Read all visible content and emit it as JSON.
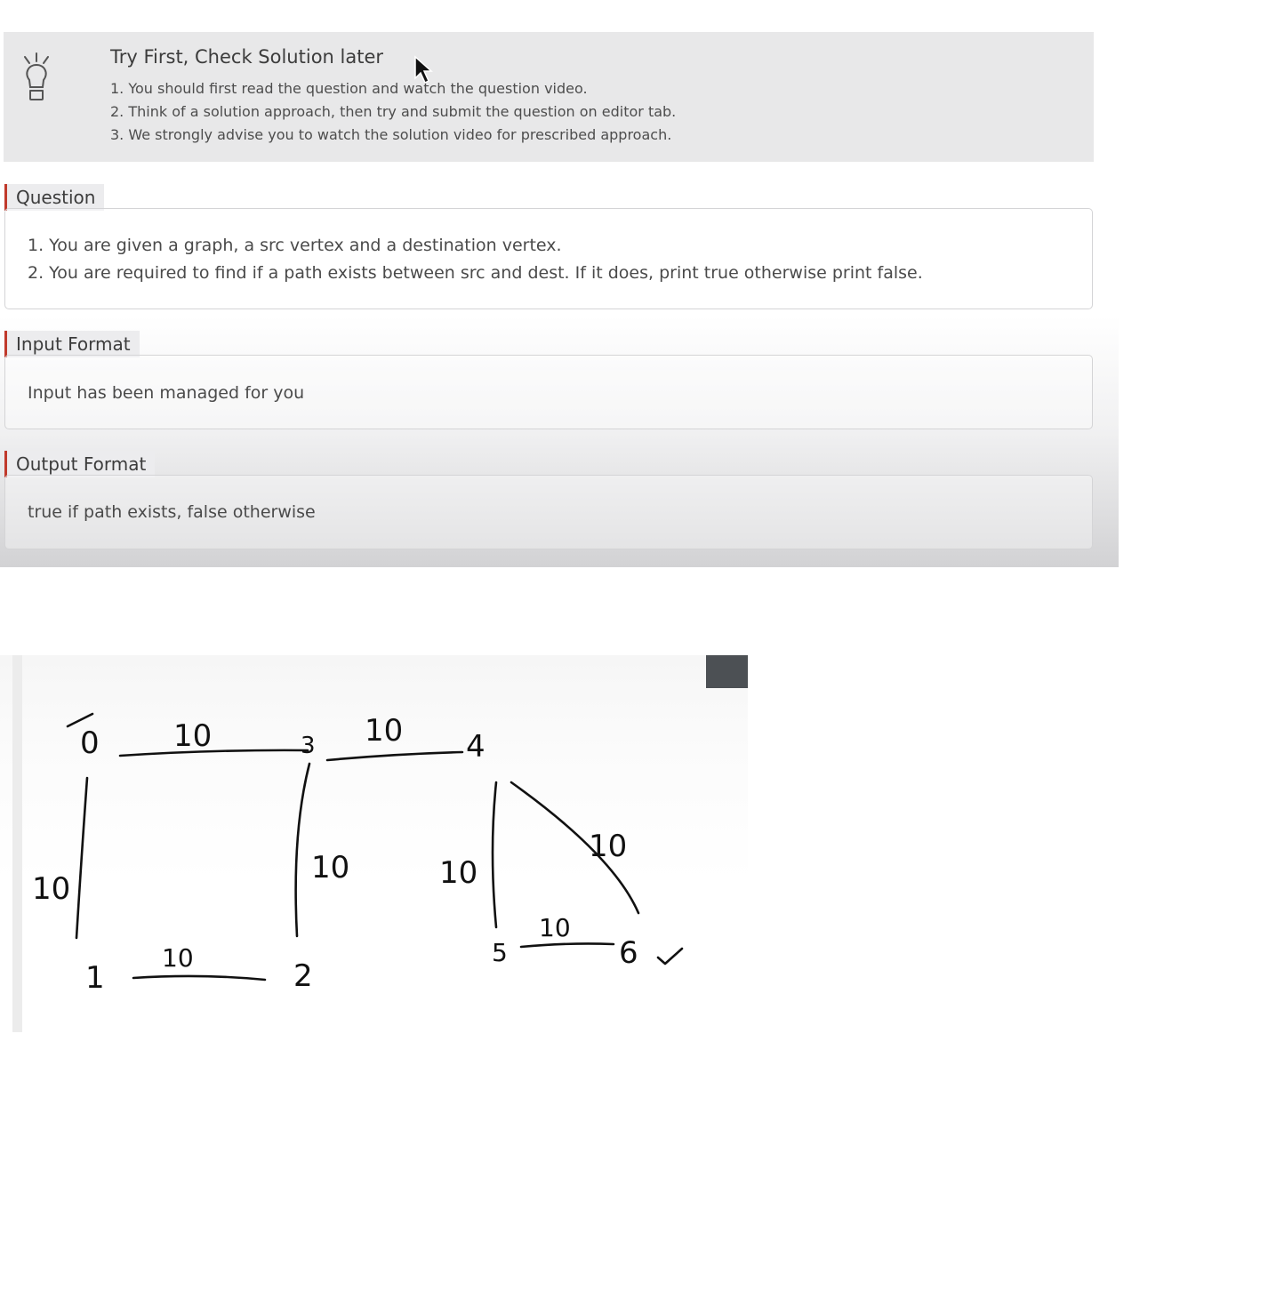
{
  "tip": {
    "title": "Try First, Check Solution later",
    "lines": [
      "1. You should first read the question and watch the question video.",
      "2. Think of a solution approach, then try and submit the question on editor tab.",
      "3. We strongly advise you to watch the solution video for prescribed approach."
    ],
    "icon": "lightbulb-icon"
  },
  "question": {
    "label": "Question",
    "lines": [
      "1. You are given a graph, a src vertex and a destination vertex.",
      "2. You are required to find if a path exists between src and dest. If it does, print true otherwise print false."
    ]
  },
  "input_format": {
    "label": "Input Format",
    "text": "Input has been managed for you"
  },
  "output_format": {
    "label": "Output Format",
    "text": "true if path exists, false otherwise"
  },
  "whiteboard": {
    "vertices": [
      "0",
      "1",
      "2",
      "3",
      "4",
      "5",
      "6"
    ],
    "edge_weights": [
      "10",
      "10",
      "10",
      "10",
      "10",
      "10",
      "10",
      "10"
    ],
    "check_mark": "✓"
  },
  "colors": {
    "accent_bar": "#c0392b",
    "panel_bg": "#e8e8e9",
    "corner_block": "#4c5054"
  }
}
